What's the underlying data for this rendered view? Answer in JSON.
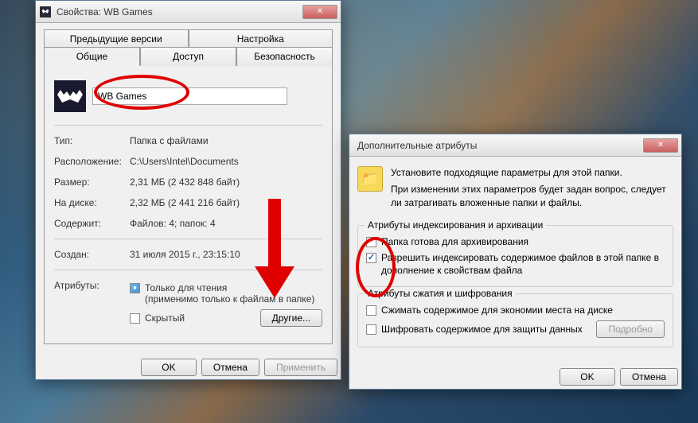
{
  "win1": {
    "title": "Свойства: WB Games",
    "tabs_row1": [
      "Предыдущие версии",
      "Настройка"
    ],
    "tabs_row2": [
      "Общие",
      "Доступ",
      "Безопасность"
    ],
    "folder_name": "WB Games",
    "props": {
      "type_label": "Тип:",
      "type_value": "Папка с файлами",
      "location_label": "Расположение:",
      "location_value": "C:\\Users\\Intel\\Documents",
      "size_label": "Размер:",
      "size_value": "2,31 МБ (2 432 848 байт)",
      "ondisk_label": "На диске:",
      "ondisk_value": "2,32 МБ (2 441 216 байт)",
      "contains_label": "Содержит:",
      "contains_value": "Файлов: 4; папок: 4",
      "created_label": "Создан:",
      "created_value": "31 июля 2015 г., 23:15:10",
      "attrs_label": "Атрибуты:"
    },
    "readonly_label": "Только для чтения",
    "readonly_hint": "(применимо только к файлам в папке)",
    "hidden_label": "Скрытый",
    "other_btn": "Другие...",
    "ok": "OK",
    "cancel": "Отмена",
    "apply": "Применить"
  },
  "win2": {
    "title": "Дополнительные атрибуты",
    "info_line1": "Установите подходящие параметры для этой папки.",
    "info_line2": "При изменении этих параметров будет задан вопрос, следует ли затрагивать вложенные папки и файлы.",
    "group1_title": "Атрибуты индексирования и архивации",
    "archive_label": "Папка готова для архивирования",
    "index_label": "Разрешить индексировать содержимое файлов в этой папке в дополнение к свойствам файла",
    "group2_title": "Атрибуты сжатия и шифрования",
    "compress_label": "Сжимать содержимое для экономии места на диске",
    "encrypt_label": "Шифровать содержимое для защиты данных",
    "details_btn": "Подробно",
    "ok": "OK",
    "cancel": "Отмена"
  }
}
